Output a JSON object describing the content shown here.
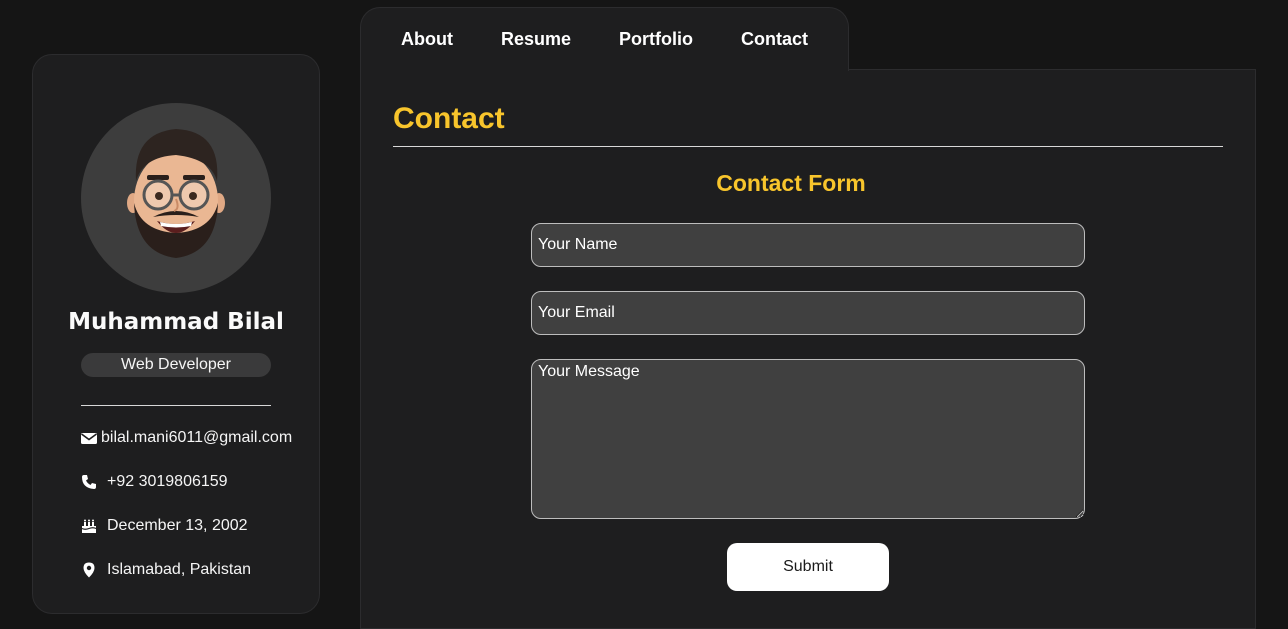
{
  "profile": {
    "avatar_icon": "memoji-avatar",
    "name": "Muhammad Bilal",
    "role": "Web Developer",
    "email": "bilal.mani6011@gmail.com",
    "phone": "+92 3019806159",
    "birthday": "December 13, 2002",
    "location": "Islamabad, Pakistan"
  },
  "nav": {
    "tabs": [
      {
        "label": "About"
      },
      {
        "label": "Resume"
      },
      {
        "label": "Portfolio"
      },
      {
        "label": "Contact"
      }
    ],
    "active": "Contact"
  },
  "contact": {
    "title": "Contact",
    "form_title": "Contact Form",
    "name_placeholder": "Your Name",
    "email_placeholder": "Your Email",
    "message_placeholder": "Your Message",
    "submit_label": "Submit"
  },
  "colors": {
    "background": "#151515",
    "panel": "#1e1e1f",
    "accent": "#f8c52c",
    "field": "#404040"
  }
}
